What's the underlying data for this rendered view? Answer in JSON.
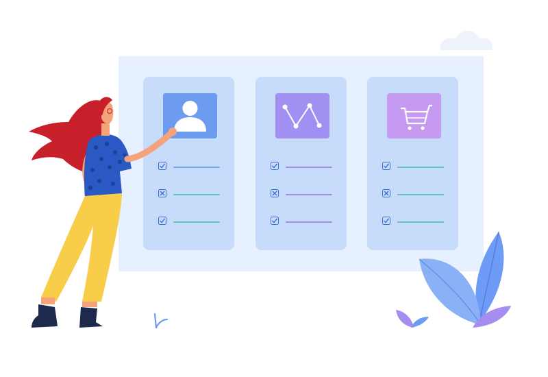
{
  "colors": {
    "board": "#e7f0fe",
    "card": "#c7dbfa",
    "icon_user_bg": "#6c9bf0",
    "icon_chart_bg": "#a18ff2",
    "icon_cart_bg": "#c59af0",
    "check": "#3d6fd1",
    "line_blue": "#74a5ea",
    "line_teal": "#5cc4b8",
    "line_purple": "#a88ae8",
    "hair": "#c8202a",
    "shirt": "#2b59c3",
    "pants": "#f7cd4a",
    "leaf": "#6d9bf5",
    "leaf_purple": "#a58ef0"
  },
  "cards": [
    {
      "icon": "user-icon",
      "items": [
        "check",
        "cross",
        "check"
      ]
    },
    {
      "icon": "line-chart-icon",
      "items": [
        "check",
        "cross",
        "check"
      ]
    },
    {
      "icon": "shopping-cart-icon",
      "items": [
        "check",
        "cross",
        "check"
      ]
    }
  ]
}
